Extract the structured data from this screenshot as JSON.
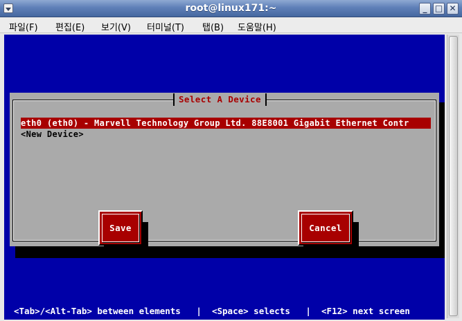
{
  "window": {
    "title": "root@linux171:~",
    "minimize_label": "_",
    "maximize_label": "□",
    "close_label": "✕"
  },
  "menubar": {
    "items": [
      {
        "label": "파일(F)"
      },
      {
        "label": "편집(E)"
      },
      {
        "label": "보기(V)"
      },
      {
        "label": "터미널(T)"
      },
      {
        "label": "탭(B)"
      },
      {
        "label": "도움말(H)"
      }
    ]
  },
  "dialog": {
    "title": "Select A Device",
    "devices": [
      {
        "label": "eth0 (eth0) - Marvell Technology Group Ltd. 88E8001 Gigabit Ethernet Contr",
        "selected": true
      },
      {
        "label": "<New Device>",
        "selected": false
      }
    ],
    "save_label": "Save",
    "cancel_label": "Cancel"
  },
  "statusline": {
    "text": "<Tab>/<Alt-Tab> between elements   |  <Space> selects   |  <F12> next screen"
  },
  "colors": {
    "terminal_bg": "#0000a8",
    "dialog_bg": "#aaaaaa",
    "accent_red": "#a80000",
    "titlebar_blue": "#5f80b8"
  },
  "icons": {
    "window_menu": "window-menu-icon",
    "minimize": "minimize-icon",
    "maximize": "maximize-icon",
    "close": "close-icon"
  }
}
